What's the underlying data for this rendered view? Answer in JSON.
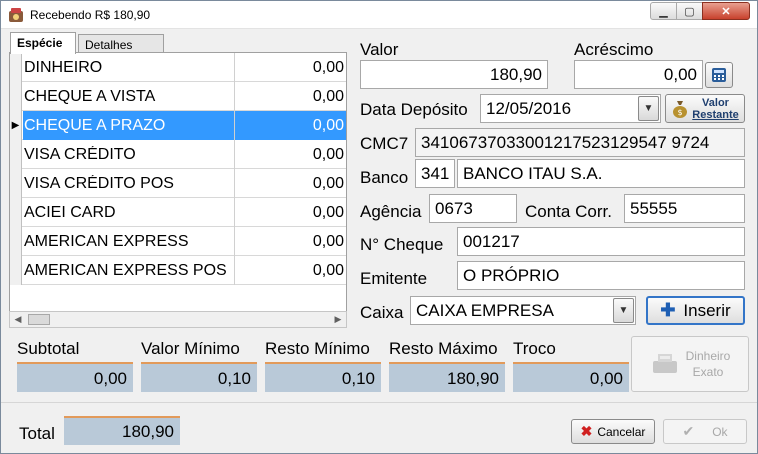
{
  "window": {
    "title": "Recebendo R$ 180,90"
  },
  "tabs": [
    {
      "label": "Espécie"
    },
    {
      "label": "Detalhes"
    }
  ],
  "especies": [
    {
      "name": "DINHEIRO",
      "value": "0,00",
      "marker": ""
    },
    {
      "name": "CHEQUE A VISTA",
      "value": "0,00",
      "marker": ""
    },
    {
      "name": "CHEQUE A PRAZO",
      "value": "0,00",
      "marker": "▶"
    },
    {
      "name": "VISA CRÉDITO",
      "value": "0,00",
      "marker": ""
    },
    {
      "name": "VISA CRÉDITO POS",
      "value": "0,00",
      "marker": ""
    },
    {
      "name": "ACIEI CARD",
      "value": "0,00",
      "marker": ""
    },
    {
      "name": "AMERICAN EXPRESS",
      "value": "0,00",
      "marker": ""
    },
    {
      "name": "AMERICAN EXPRESS POS",
      "value": "0,00",
      "marker": ""
    }
  ],
  "selected_index": 2,
  "form": {
    "valor_label": "Valor",
    "valor": "180,90",
    "acrescimo_label": "Acréscimo",
    "acrescimo": "0,00",
    "data_deposito_label": "Data Depósito",
    "data_deposito": "12/05/2016",
    "valor_restante_line1": "Valor",
    "valor_restante_line2": "Restante",
    "cmc7_label": "CMC7",
    "cmc7": "34106737033001217523129547 9724",
    "banco_label": "Banco",
    "banco_codigo": "341",
    "banco_nome": "BANCO ITAU S.A.",
    "agencia_label": "Agência",
    "agencia": "0673",
    "conta_label": "Conta Corr.",
    "conta": "55555",
    "n_cheque_label": "N° Cheque",
    "n_cheque": "001217",
    "emitente_label": "Emitente",
    "emitente": "O PRÓPRIO",
    "caixa_label": "Caixa",
    "caixa": "CAIXA EMPRESA",
    "inserir_label": "Inserir"
  },
  "summary": {
    "subtotal_label": "Subtotal",
    "subtotal": "0,00",
    "valor_minimo_label": "Valor Mínimo",
    "valor_minimo": "0,10",
    "resto_minimo_label": "Resto Mínimo",
    "resto_minimo": "0,10",
    "resto_maximo_label": "Resto Máximo",
    "resto_maximo": "180,90",
    "troco_label": "Troco",
    "troco": "0,00",
    "dinheiro_exato_line1": "Dinheiro",
    "dinheiro_exato_line2": "Exato"
  },
  "footer": {
    "total_label": "Total",
    "total": "180,90",
    "cancelar_label": "Cancelar",
    "ok_label": "Ok"
  },
  "colors": {
    "selection": "#3399ff",
    "summary_box": "#b9c9d8",
    "summary_accent": "#e29a5a",
    "inserir_border": "#3375c8"
  },
  "icons": [
    "app-icon",
    "minimize-icon",
    "maximize-icon",
    "close-icon",
    "calculator-icon",
    "money-bag-icon",
    "plus-icon",
    "cash-register-icon",
    "cancel-x-icon",
    "check-icon",
    "dropdown-arrow-icon",
    "row-pointer-icon",
    "scroll-left-icon",
    "scroll-right-icon"
  ]
}
